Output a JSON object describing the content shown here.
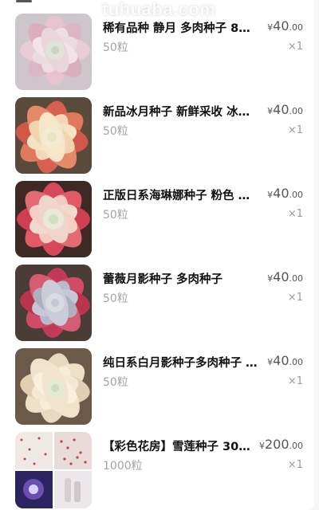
{
  "watermark": "tuhuaba.com",
  "items": [
    {
      "title": "稀有品种 静月   多肉种子 8…",
      "spec": "50粒",
      "currency": "¥",
      "price_int": "40",
      "price_dec": ".00",
      "count": "×1"
    },
    {
      "title": "新品冰月种子 新鲜采收 冰莓…",
      "spec": "50粒",
      "currency": "¥",
      "price_int": "40",
      "price_dec": ".00",
      "count": "×1"
    },
    {
      "title": "正版日系海琳娜种子  粉色 贵…",
      "spec": "50粒",
      "currency": "¥",
      "price_int": "40",
      "price_dec": ".00",
      "count": "×1"
    },
    {
      "title": "蕾薇月影种子   多肉种子",
      "spec": "50粒",
      "currency": "¥",
      "price_int": "40",
      "price_dec": ".00",
      "count": "×1"
    },
    {
      "title": "纯日系白月影种子多肉种子  …",
      "spec": "50粒",
      "currency": "¥",
      "price_int": "40",
      "price_dec": ".00",
      "count": "×1"
    },
    {
      "title": "【彩色花房】雪莲种子 30…",
      "spec": "1000粒",
      "currency": "¥",
      "price_int": "200",
      "price_dec": ".00",
      "count": "×1"
    }
  ]
}
